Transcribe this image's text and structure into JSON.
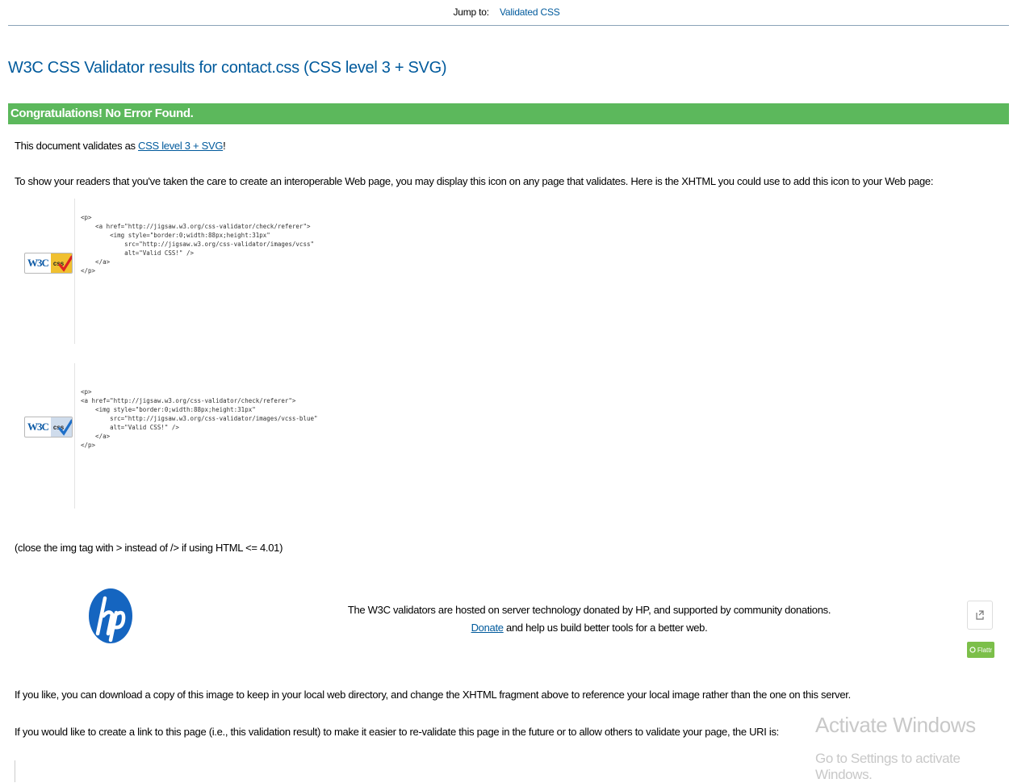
{
  "nav": {
    "jump_label": "Jump to:",
    "jump_link": "Validated CSS"
  },
  "title": "W3C CSS Validator results for contact.css (CSS level 3 + SVG)",
  "banner": "Congratulations! No Error Found.",
  "validates": {
    "prefix": "This document validates as",
    "link": "CSS level 3 + SVG",
    "suffix": "!"
  },
  "intro": "To show your readers that you've taken the care to create an interoperable Web page, you may display this icon on any page that validates. Here is the XHTML you could use to add this icon to your Web page:",
  "icons": [
    {
      "badge_w3c": "W3C",
      "badge_css": "css",
      "code": "<p>\n    <a href=\"http://jigsaw.w3.org/css-validator/check/referer\">\n        <img style=\"border:0;width:88px;height:31px\"\n            src=\"http://jigsaw.w3.org/css-validator/images/vcss\"\n            alt=\"Valid CSS!\" />\n    </a>\n</p>"
    },
    {
      "badge_w3c": "W3C",
      "badge_css": "css",
      "code": "<p>\n<a href=\"http://jigsaw.w3.org/css-validator/check/referer\">\n    <img style=\"border:0;width:88px;height:31px\"\n        src=\"http://jigsaw.w3.org/css-validator/images/vcss-blue\"\n        alt=\"Valid CSS!\" />\n    </a>\n</p>"
    }
  ],
  "close_note": "(close the img tag with > instead of /> if using HTML <= 4.01)",
  "hosted": {
    "line1": "The W3C validators are hosted on server technology donated by HP, and supported by community donations.",
    "donate_link": "Donate",
    "line2_rest": " and help us build better tools for a better web."
  },
  "flattr_label": "Flattr",
  "download_note": "If you like, you can download a copy of this image to keep in your local web directory, and change the XHTML fragment above to reference your local image rather than the one on this server.",
  "link_note": "If you would like to create a link to this page (i.e., this validation result) to make it easier to re-validate this page in the future or to allow others to validate your page, the URI is:",
  "watermark": {
    "line1": "Activate Windows",
    "line2": "Go to Settings to activate Windows."
  },
  "colors": {
    "link": "#005a9c",
    "banner": "#5cb85c",
    "hp_blue": "#1565c0"
  }
}
